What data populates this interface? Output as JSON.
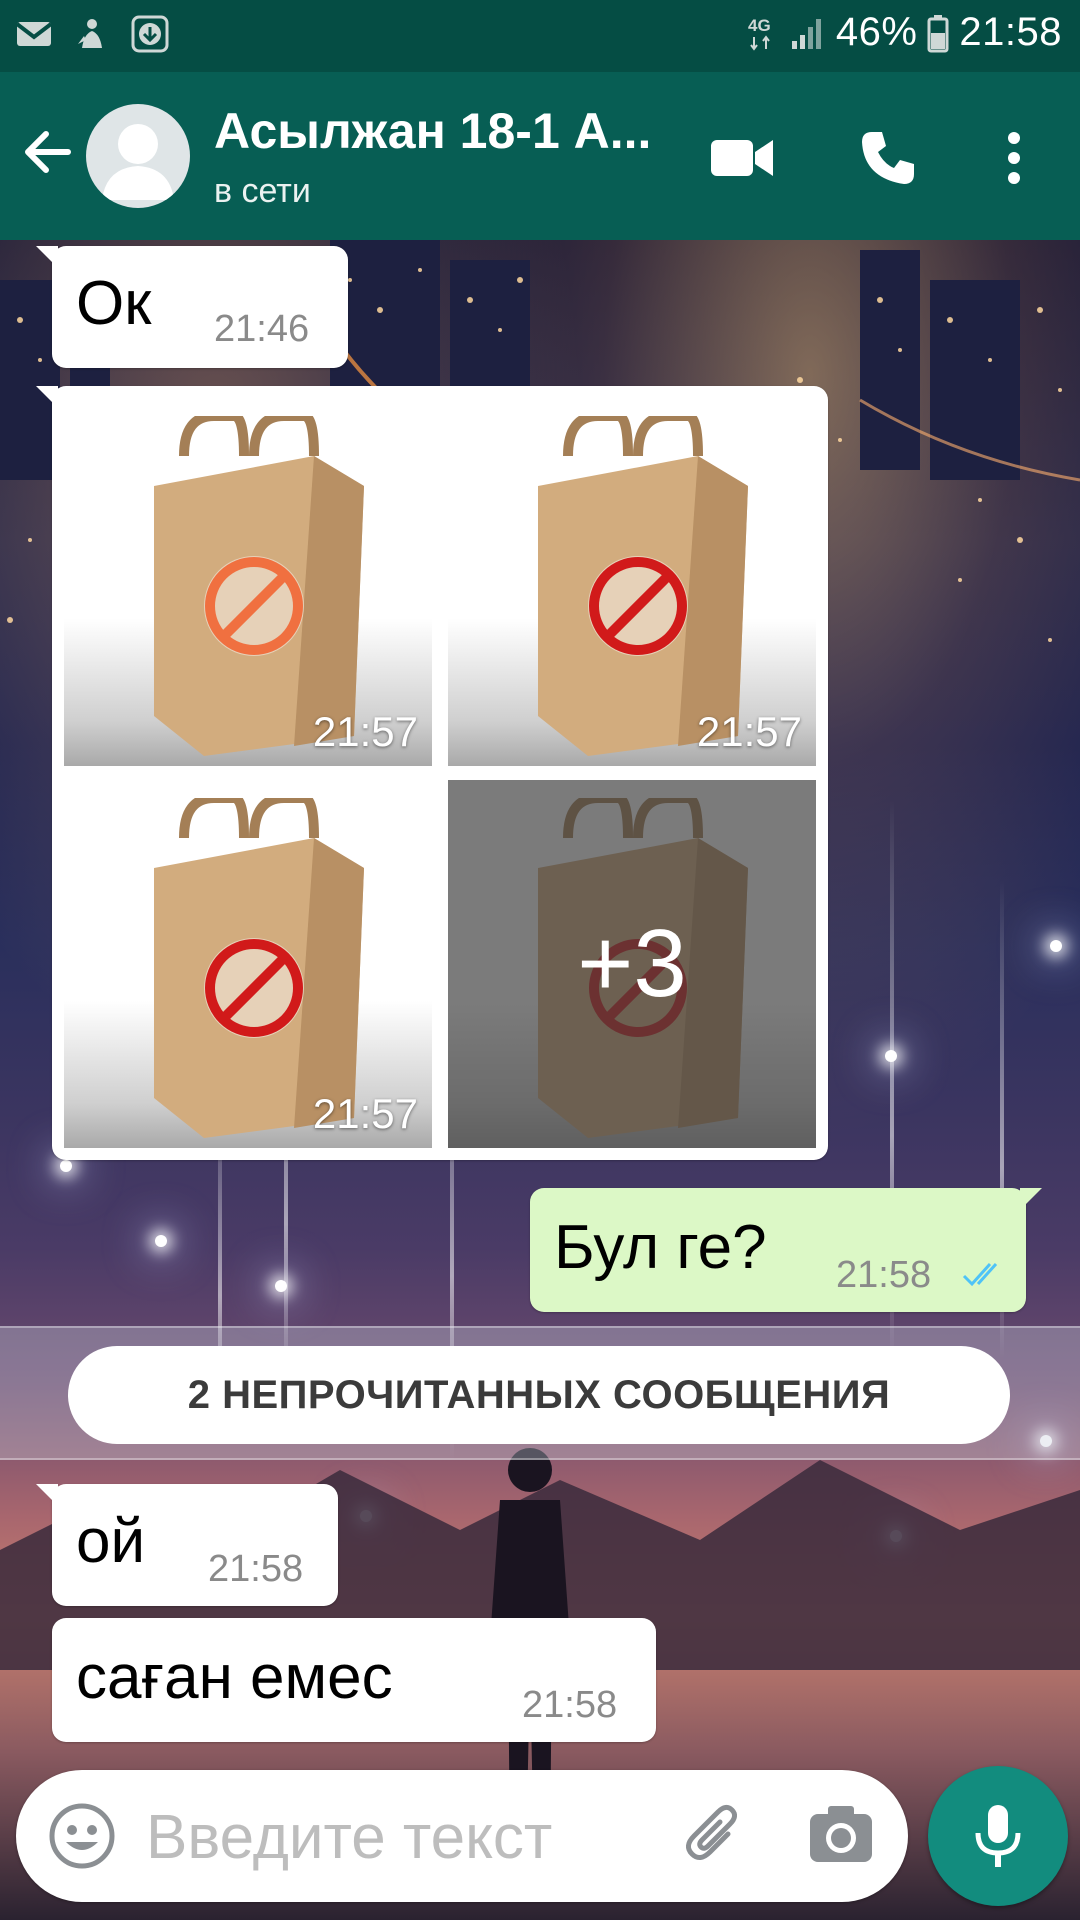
{
  "status_bar": {
    "network": "4G",
    "battery": "46%",
    "time": "21:58",
    "left_icons": [
      "gmail-icon",
      "notification-icon",
      "download-icon"
    ]
  },
  "header": {
    "contact_name": "Асылжан 18-1 А...",
    "contact_status": "в сети",
    "icons": [
      "back-arrow-icon",
      "avatar",
      "video-call-icon",
      "phone-icon",
      "more-options-icon"
    ]
  },
  "messages": [
    {
      "direction": "in",
      "text": "Ок",
      "time": "21:46"
    },
    {
      "direction": "in",
      "type": "media-album",
      "times": [
        "21:57",
        "21:57",
        "21:57"
      ],
      "more_count": "+3"
    },
    {
      "direction": "out",
      "text": "Бул ге?",
      "time": "21:58",
      "status": "read"
    }
  ],
  "unread_banner": "2 НЕПРОЧИТАННЫХ СООБЩЕНИЯ",
  "new_messages": [
    {
      "direction": "in",
      "text": "ой",
      "time": "21:58"
    },
    {
      "direction": "in",
      "text": "саған емес",
      "time": "21:58"
    }
  ],
  "composer": {
    "placeholder": "Введите текст"
  },
  "colors": {
    "header": "#075e54",
    "status_bar": "#054d44",
    "outgoing_bubble": "#dcf8c6",
    "mic_button": "#128c7e",
    "read_ticks": "#4fc3f7"
  }
}
